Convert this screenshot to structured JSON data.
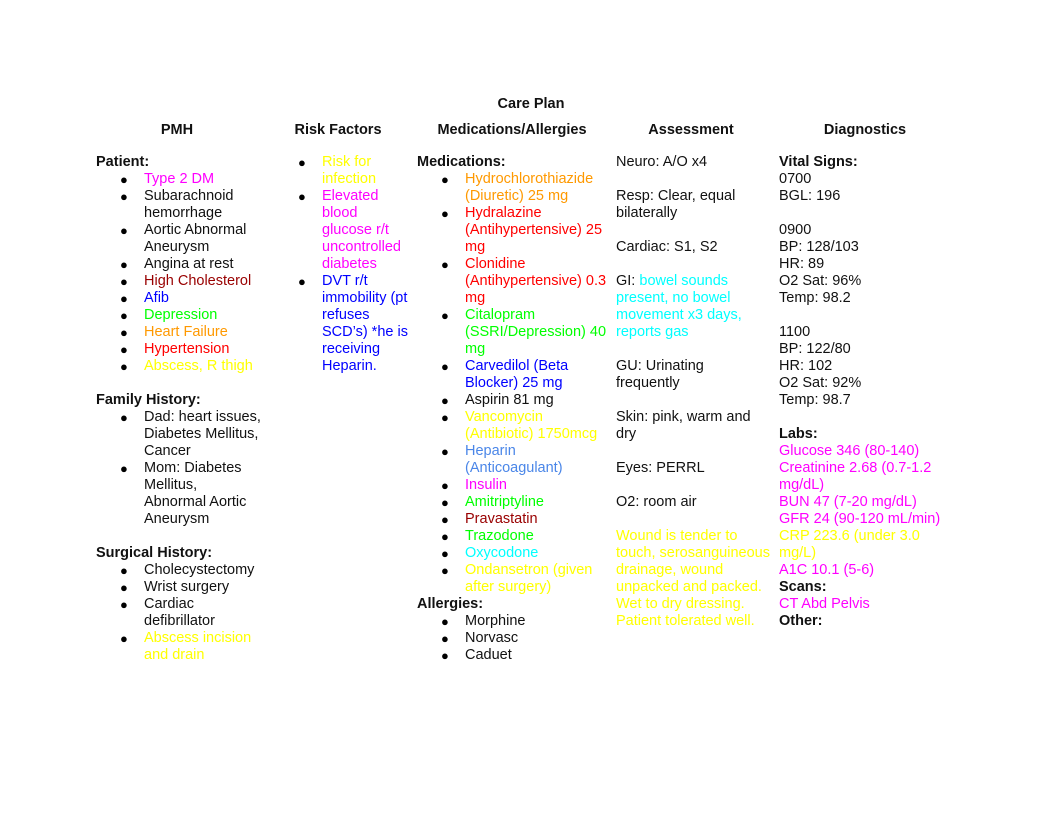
{
  "title": "Care Plan",
  "colors": {
    "black": "#111111",
    "magenta": "#ff00ff",
    "dark_red": "#990000",
    "blue": "#0000ff",
    "green": "#00ff00",
    "orange": "#ff9900",
    "red": "#ff0000",
    "yellow": "#ffff00",
    "cyan": "#00ffff",
    "cornflower": "#4a86e8"
  },
  "pmh": {
    "heading": "PMH",
    "patient_label": "Patient:",
    "patient": [
      {
        "text": "Type 2 DM",
        "color": "#ff00ff"
      },
      {
        "text": "Subarachnoid hemorrhage",
        "color": "#111111"
      },
      {
        "text": "Aortic Abnormal Aneurysm",
        "color": "#111111"
      },
      {
        "text": "Angina at rest",
        "color": "#111111"
      },
      {
        "text": "High Cholesterol",
        "color": "#990000"
      },
      {
        "text": "Afib",
        "color": "#0000ff"
      },
      {
        "text": "Depression",
        "color": "#00ff00"
      },
      {
        "text": "Heart Failure",
        "color": "#ff9900"
      },
      {
        "text": "Hypertension",
        "color": "#ff0000"
      },
      {
        "text": "Abscess, R thigh",
        "color": "#ffff00"
      }
    ],
    "family_label": "Family History:",
    "family": [
      {
        "text": "Dad: heart issues, Diabetes Mellitus, Cancer",
        "color": "#111111"
      },
      {
        "text": "Mom: Diabetes Mellitus, Abnormal Aortic Aneurysm",
        "color": "#111111"
      }
    ],
    "surgical_label": "Surgical History:",
    "surgical": [
      {
        "text": "Cholecystectomy",
        "color": "#111111"
      },
      {
        "text": "Wrist surgery",
        "color": "#111111"
      },
      {
        "text": "Cardiac defibrillator",
        "color": "#111111"
      },
      {
        "text": "Abscess incision and drain",
        "color": "#ffff00"
      }
    ]
  },
  "risk_factors": {
    "heading": "Risk Factors",
    "items": [
      {
        "text": "Risk for infection",
        "color": "#ffff00"
      },
      {
        "text": "Elevated blood glucose r/t uncontrolled diabetes",
        "color": "#ff00ff"
      },
      {
        "text": "DVT r/t immobility (pt refuses SCD’s) *he is receiving Heparin.",
        "color": "#0000ff"
      }
    ]
  },
  "medications": {
    "heading": "Medications/Allergies",
    "meds_label": "Medications:",
    "meds": [
      {
        "text": "Hydrochlorothiazide (Diuretic) 25 mg",
        "color": "#ff9900"
      },
      {
        "text": "Hydralazine (Antihypertensive) 25 mg",
        "color": "#ff0000"
      },
      {
        "text": "Clonidine (Antihypertensive) 0.3 mg",
        "color": "#ff0000"
      },
      {
        "text": "Citalopram (SSRI/Depression) 40 mg",
        "color": "#00ff00"
      },
      {
        "text": "Carvedilol (Beta Blocker) 25 mg",
        "color": "#0000ff"
      },
      {
        "text": "Aspirin 81 mg",
        "color": "#111111"
      },
      {
        "text": "Vancomycin (Antibiotic) 1750mcg",
        "color": "#ffff00"
      },
      {
        "text": "Heparin (Anticoagulant)",
        "color": "#4a86e8"
      },
      {
        "text": "Insulin",
        "color": "#ff00ff"
      },
      {
        "text": "Amitriptyline",
        "color": "#00ff00"
      },
      {
        "text": "Pravastatin",
        "color": "#990000"
      },
      {
        "text": "Trazodone",
        "color": "#00ff00"
      },
      {
        "text": "Oxycodone",
        "color": "#00ffff"
      },
      {
        "text": "Ondansetron (given after surgery)",
        "color": "#ffff00"
      }
    ],
    "allergies_label": "Allergies:",
    "allergies": [
      {
        "text": "Morphine",
        "color": "#111111"
      },
      {
        "text": "Norvasc",
        "color": "#111111"
      },
      {
        "text": "Caduet",
        "color": "#111111"
      }
    ]
  },
  "assessment": {
    "heading": "Assessment",
    "neuro": "Neuro: A/O x4",
    "resp": "Resp: Clear, equal bilaterally",
    "cardiac": "Cardiac: S1, S2",
    "gi_label": "GI: ",
    "gi_text": "bowel sounds present, no bowel movement x3 days, reports gas",
    "gu": "GU: Urinating frequently",
    "skin": "Skin: pink, warm and dry",
    "eyes": "Eyes: PERRL",
    "o2": "O2: room air",
    "wound": "Wound is tender to touch, serosanguineous drainage, wound unpacked and packed. Wet to dry dressing. Patient tolerated well."
  },
  "diagnostics": {
    "heading": "Diagnostics",
    "vitals_label": "Vital Signs:",
    "vitals": [
      {
        "time": "0700",
        "lines": [
          "BGL: 196"
        ]
      },
      {
        "time": "0900",
        "lines": [
          "BP: 128/103",
          "HR: 89",
          "O2 Sat: 96%",
          "Temp: 98.2"
        ]
      },
      {
        "time": "1100",
        "lines": [
          "BP: 122/80",
          "HR: 102",
          "O2 Sat: 92%",
          "Temp: 98.7"
        ]
      }
    ],
    "labs_label": "Labs:",
    "labs": [
      {
        "text": "Glucose 346 (80-140)",
        "color": "#ff00ff"
      },
      {
        "text": "Creatinine 2.68 (0.7-1.2 mg/dL)",
        "color": "#ff00ff"
      },
      {
        "text": "BUN 47 (7-20 mg/dL)",
        "color": "#ff00ff"
      },
      {
        "text": "GFR 24 (90-120 mL/min)",
        "color": "#ff00ff"
      },
      {
        "text": "CRP 223.6 (under 3.0 mg/L)",
        "color": "#ffff00"
      },
      {
        "text": "A1C 10.1 (5-6)",
        "color": "#ff00ff"
      }
    ],
    "scans_label": "Scans:",
    "scans": [
      {
        "text": "CT Abd Pelvis",
        "color": "#ff00ff"
      }
    ],
    "other_label": "Other:"
  }
}
